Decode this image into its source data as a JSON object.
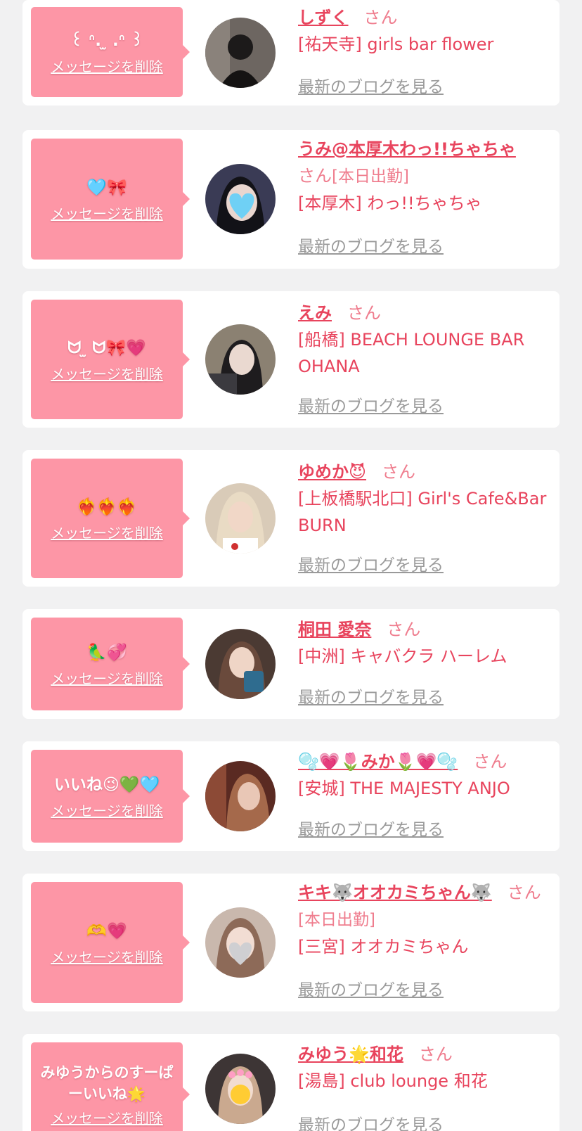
{
  "common": {
    "delete_label": "メッセージを削除",
    "san": "さん",
    "blog_label": "最新のブログを見る"
  },
  "colors": {
    "background": "#f1f1f2",
    "bubble": "#fd96a6",
    "accent": "#e8445d",
    "muted": "#9a9a9a"
  },
  "items": [
    {
      "message": "꒰ ᐢ. ̫ .ᐢ ꒱",
      "name": "しずく",
      "status": "",
      "shop": "[祐天寺] girls bar flower"
    },
    {
      "message": "🩵🎀",
      "name": "うみ@本厚木わっ!!ちゃちゃ",
      "status": "[本日出勤]",
      "shop": "[本厚木] わっ!!ちゃちゃ"
    },
    {
      "message": "ᗢ ̫ ᗢ🎀💗",
      "name": "えみ",
      "status": "",
      "shop": "[船橋] BEACH LOUNGE BAR OHANA"
    },
    {
      "message": "❤️‍🔥❤️‍🔥❤️‍🔥",
      "name": "ゆめか😈",
      "status": "",
      "shop": "[上板橋駅北口] Girl's Cafe&Bar BURN"
    },
    {
      "message": "🦜💞",
      "name": "桐田 愛奈",
      "status": "",
      "shop": "[中洲] キャバクラ ハーレム"
    },
    {
      "message": "いいね😉💚🩵",
      "name": "🫧💗🌷みか🌷💗🫧",
      "status": "",
      "shop": "[安城] THE MAJESTY ANJO"
    },
    {
      "message": "🫶💗",
      "name": "キキ🐺オオカミちゃん🐺",
      "status": "[本日出勤]",
      "shop": "[三宮] オオカミちゃん"
    },
    {
      "message": "みゆうからのすーぱーいいね🌟",
      "name": "みゆう🌟和花",
      "status": "",
      "shop": "[湯島] club lounge 和花"
    }
  ]
}
